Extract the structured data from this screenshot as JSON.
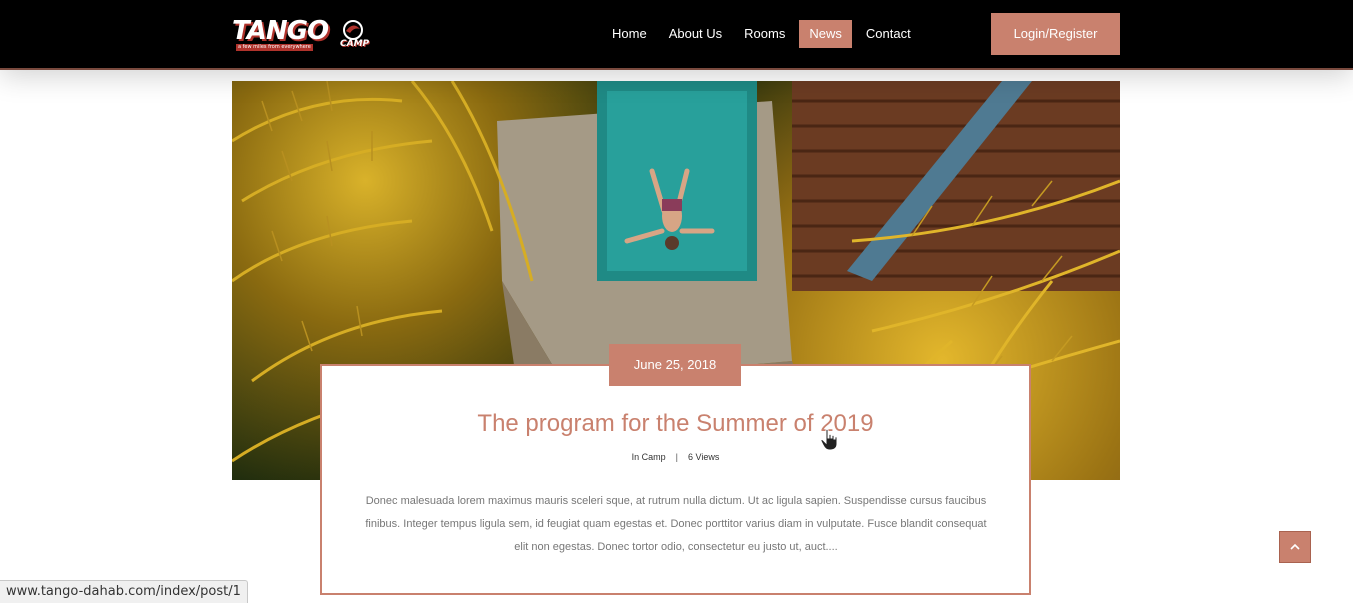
{
  "header": {
    "logo": {
      "word": "TANGO",
      "sub": "CAMP",
      "tagline": "a few miles from everywhere"
    },
    "nav": [
      {
        "label": "Home",
        "active": false
      },
      {
        "label": "About Us",
        "active": false
      },
      {
        "label": "Rooms",
        "active": false
      },
      {
        "label": "News",
        "active": true
      },
      {
        "label": "Contact",
        "active": false
      }
    ],
    "login_label": "Login/Register"
  },
  "post": {
    "date": "June 25, 2018",
    "title": "The program for the Summer of 2019",
    "category": "In Camp",
    "views": "6 Views",
    "excerpt": "Donec malesuada lorem maximus mauris sceleri sque, at rutrum nulla dictum. Ut ac ligula sapien. Suspendisse cursus faucibus finibus. Integer tempus ligula sem, id feugiat quam egestas et. Donec porttitor varius diam in vulputate. Fusce blandit consequat elit non egestas. Donec tortor odio, consectetur eu justo ut, auct...."
  },
  "status_bar": {
    "url": "www.tango-dahab.com/index/post/1"
  },
  "colors": {
    "accent": "#c9816e",
    "header_bg": "#000000"
  },
  "icons": {
    "to_top": "chevron-up-icon",
    "cursor": "hand-pointer-icon"
  }
}
